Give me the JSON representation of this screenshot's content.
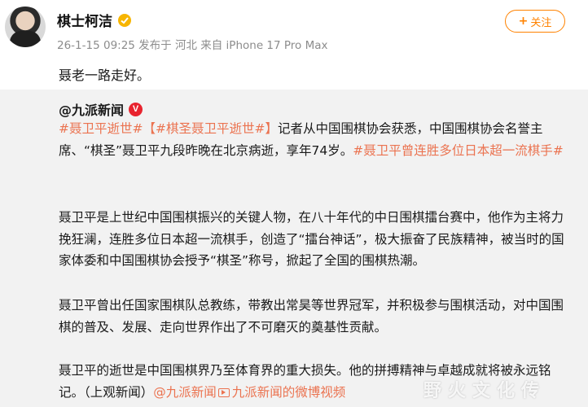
{
  "post": {
    "username": "棋士柯洁",
    "meta": "26-1-15 09:25 发布于 河北 来自 iPhone 17 Pro Max",
    "follow_label": "关注",
    "follow_plus": "+",
    "text": "聂老一路走好。"
  },
  "repost": {
    "author": "@九派新闻",
    "verify_badge": "V",
    "para1": {
      "tag1": "#聂卫平逝世#",
      "tag2": "【#棋圣聂卫平逝世#】",
      "body": "记者从中国围棋协会获悉，中国围棋协会名誉主席、“棋圣”聂卫平九段昨晚在北京病逝，享年74岁。",
      "tag3": "#聂卫平曾连胜多位日本超一流棋手#"
    },
    "para2": "聂卫平是上世纪中国围棋振兴的关键人物，在八十年代的中日围棋擂台赛中，他作为主将力挽狂澜，连胜多位日本超一流棋手，创造了“擂台神话”，极大振奋了民族精神，被当时的国家体委和中国围棋协会授予“棋圣”称号，掀起了全国的围棋热潮。",
    "para3": "聂卫平曾出任国家围棋队总教练，带教出常昊等世界冠军，并积极参与围棋活动，对中国围棋的普及、发展、走向世界作出了不可磨灭的奠基性贡献。",
    "para4": {
      "body": "聂卫平的逝世是中国围棋界乃至体育界的重大损失。他的拼搏精神与卓越成就将被永远铭记。（上观新闻）",
      "link1": "@九派新闻",
      "link2": "九派新闻的微博视频"
    }
  },
  "watermark": "野火文化传",
  "colors": {
    "accent_orange": "#ff8200",
    "link": "#eb7350",
    "repost_bg": "#f2f2f2",
    "verify_red": "#e8232e"
  }
}
